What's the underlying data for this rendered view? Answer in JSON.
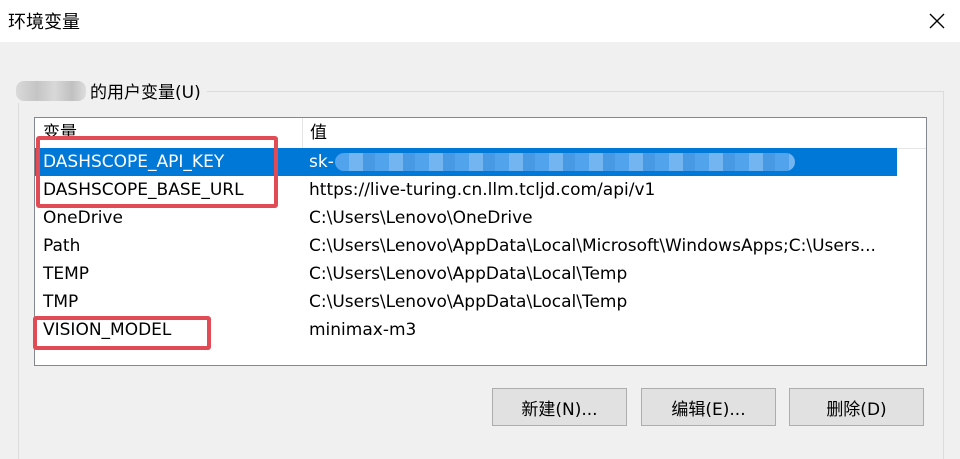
{
  "window": {
    "title": "环境变量"
  },
  "user_vars": {
    "group_label": "的用户变量(U)",
    "columns": {
      "name": "变量",
      "value": "值"
    },
    "rows": [
      {
        "name": "DASHSCOPE_API_KEY",
        "value": "sk-",
        "selected": true
      },
      {
        "name": "DASHSCOPE_BASE_URL",
        "value": "https://live-turing.cn.llm.tcljd.com/api/v1"
      },
      {
        "name": "OneDrive",
        "value": "C:\\Users\\Lenovo\\OneDrive"
      },
      {
        "name": "Path",
        "value": "C:\\Users\\Lenovo\\AppData\\Local\\Microsoft\\WindowsApps;C:\\Users..."
      },
      {
        "name": "TEMP",
        "value": "C:\\Users\\Lenovo\\AppData\\Local\\Temp"
      },
      {
        "name": "TMP",
        "value": "C:\\Users\\Lenovo\\AppData\\Local\\Temp"
      },
      {
        "name": "VISION_MODEL",
        "value": "minimax-m3"
      }
    ]
  },
  "buttons": {
    "new_label": "新建(N)...",
    "edit_label": "编辑(E)...",
    "delete_label": "删除(D)"
  },
  "colors": {
    "selection": "#0078d7",
    "highlight": "#e04b55"
  },
  "icons": {
    "close": "close-icon"
  }
}
